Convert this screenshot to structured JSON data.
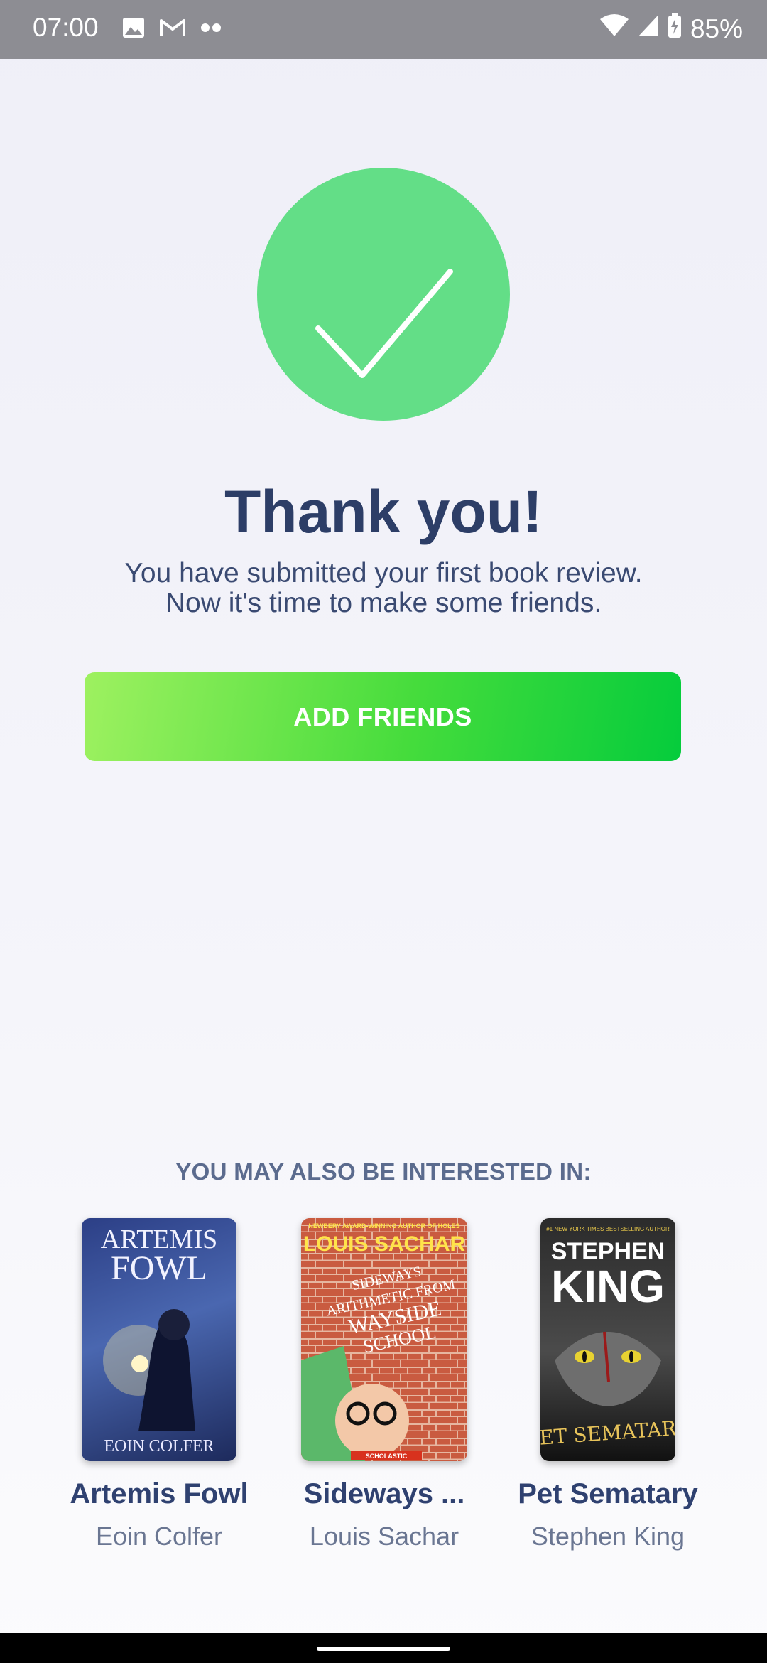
{
  "status_bar": {
    "time": "07:00",
    "battery": "85%",
    "icons_left": [
      "image-icon",
      "gmail-icon",
      "more-dots-icon"
    ],
    "icons_right": [
      "wifi-icon",
      "signal-icon",
      "battery-icon"
    ]
  },
  "main": {
    "title": "Thank you!",
    "subtitle_line1": "You have submitted your first book review.",
    "subtitle_line2": "Now it's time to make some friends.",
    "add_friends_label": "ADD FRIENDS",
    "accent_color": "#63de87"
  },
  "recommendations": {
    "heading": "YOU MAY ALSO BE INTERESTED IN:",
    "books": [
      {
        "title": "Artemis Fowl",
        "author": "Eoin Colfer",
        "cover_title_1": "ARTEMIS",
        "cover_title_2": "FOWL",
        "cover_author": "EOIN COLFER"
      },
      {
        "title": "Sideways ...",
        "author": "Louis Sachar",
        "cover_tagline": "NEWBERY AWARD-WINNING AUTHOR OF HOLES",
        "cover_author": "LOUIS SACHAR",
        "cover_title": "SIDEWAYS ARITHMETIC FROM WAYSIDE SCHOOL",
        "cover_publisher": "SCHOLASTIC"
      },
      {
        "title": "Pet Sematary",
        "author": "Stephen King",
        "cover_tagline": "#1 NEW YORK TIMES BESTSELLING AUTHOR",
        "cover_author_1": "STEPHEN",
        "cover_author_2": "KING",
        "cover_title": "PET SEMATARY"
      }
    ]
  }
}
